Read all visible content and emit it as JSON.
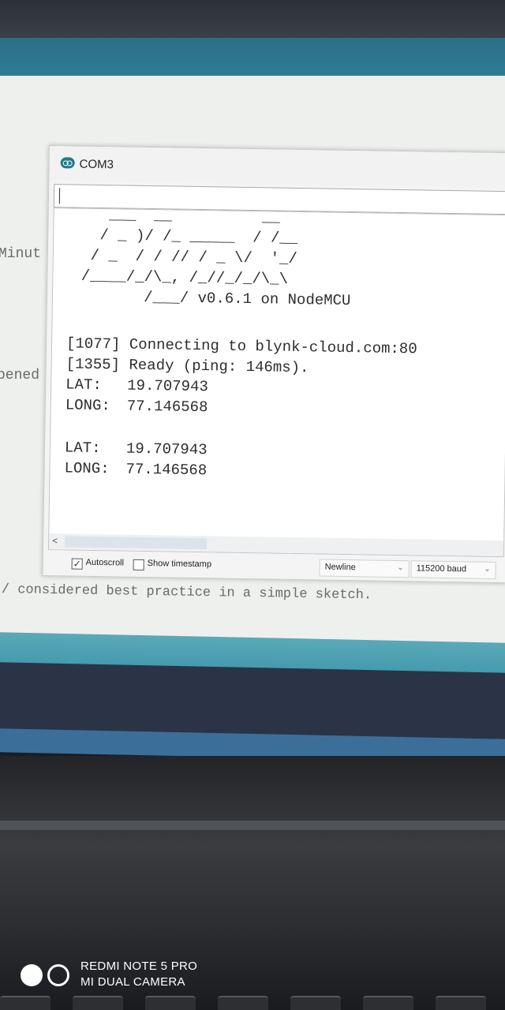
{
  "serial_monitor": {
    "window_title": "COM3",
    "send_input_value": "",
    "blynk_logo": [
      "    ___  __          __",
      "   / _ )/ /_ _____  / /__",
      "  / _  / / // / _ \\/  '_/",
      " /____/_/\\_, /_//_/_/\\_\\",
      "        /___/ v0.6.1 on NodeMCU"
    ],
    "log_lines": [
      "[1077] Connecting to blynk-cloud.com:80",
      "[1355] Ready (ping: 146ms)."
    ],
    "readings": [
      {
        "lat_label": "LAT:",
        "lat_value": "19.707943",
        "long_label": "LONG:",
        "long_value": "77.146568"
      },
      {
        "lat_label": "LAT:",
        "lat_value": "19.707943",
        "long_label": "LONG:",
        "long_value": "77.146568"
      }
    ],
    "autoscroll_label": "Autoscroll",
    "autoscroll_checked": true,
    "timestamp_label": "Show timestamp",
    "timestamp_checked": false,
    "line_ending": "Newline",
    "baud_rate": "115200 baud"
  },
  "editor_fragments": {
    "left_word_1": "Minut",
    "left_word_2": "pened",
    "comment_line": "/ considered best practice in a simple sketch."
  },
  "camera_watermark": {
    "line1": "REDMI NOTE 5 PRO",
    "line2": "MI DUAL CAMERA"
  },
  "colors": {
    "ide_teal": "#2f7c96",
    "editor_bg": "#eef0ee",
    "arduino_logo": "#1f7a8c"
  },
  "icons": {
    "window_logo": "arduino-logo-icon",
    "scroll_left": "chevron-left-icon",
    "dropdown": "chevron-down-icon"
  }
}
